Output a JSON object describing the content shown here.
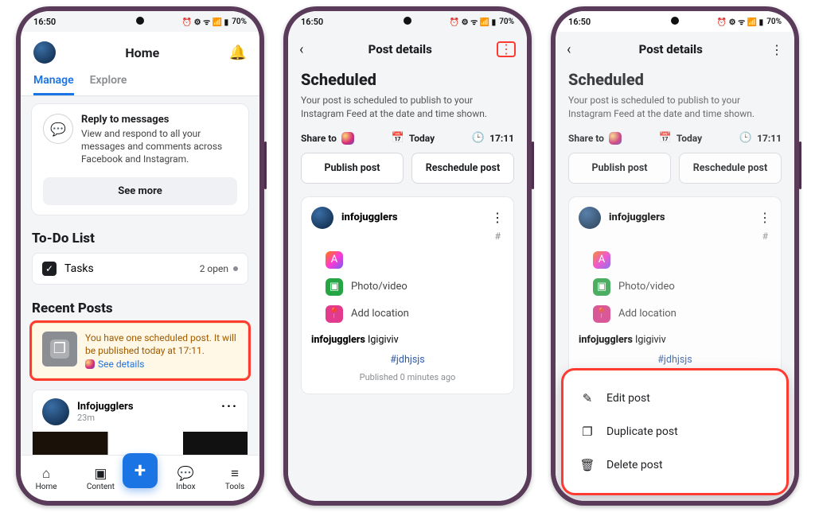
{
  "status": {
    "time": "16:50",
    "battery": "70%",
    "icons_text": "⏰ ⚙ ᯤ 📶 ▮"
  },
  "screen1": {
    "header": {
      "title": "Home"
    },
    "tabs": {
      "manage": "Manage",
      "explore": "Explore"
    },
    "reply": {
      "title": "Reply to messages",
      "sub": "View and respond to all your messages and comments across Facebook and Instagram."
    },
    "see_more": "See more",
    "sections": {
      "todo": "To-Do List",
      "recent": "Recent Posts"
    },
    "tasks": {
      "label": "Tasks",
      "open": "2 open"
    },
    "sched_banner": {
      "text": "You have one scheduled post. It will be published today at 17:11.",
      "link": "See details"
    },
    "post": {
      "name": "Infojugglers",
      "time": "23m"
    },
    "nav": {
      "home": "Home",
      "content": "Content",
      "inbox": "Inbox",
      "tools": "Tools"
    }
  },
  "details": {
    "header_title": "Post details",
    "h1": "Scheduled",
    "sub": "Your post is scheduled to publish to your Instagram Feed at the date and time shown.",
    "share_to": "Share to",
    "today": "Today",
    "time": "17:11",
    "publish": "Publish post",
    "reschedule": "Reschedule post",
    "account": "infojugglers",
    "media": {
      "photo_video": "Photo/video",
      "add_location": "Add location"
    },
    "caption_user": "infojugglers",
    "caption_text": "Igigiviv",
    "hashtag": "#jdhjsjs",
    "published": "Published 0 minutes ago"
  },
  "sheet": {
    "edit": "Edit post",
    "duplicate": "Duplicate post",
    "delete": "Delete post"
  }
}
